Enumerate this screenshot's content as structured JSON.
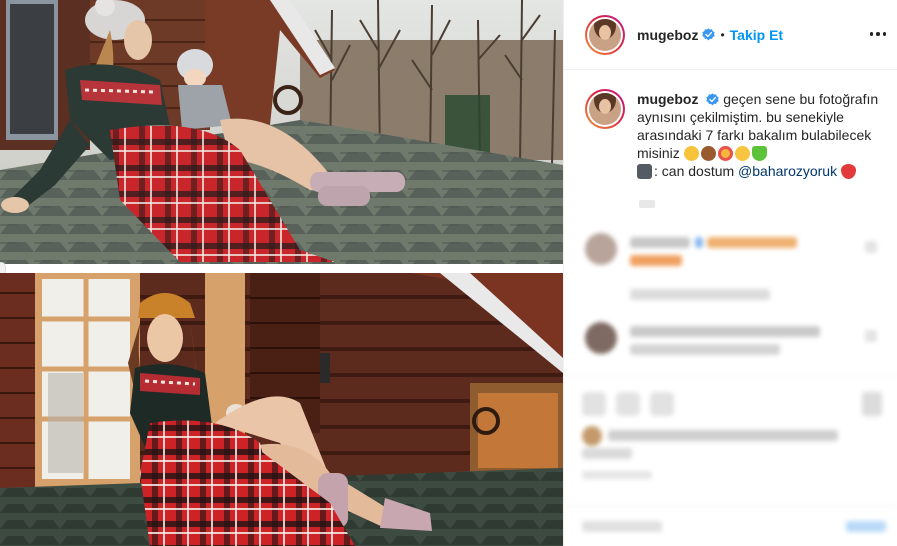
{
  "header": {
    "username": "mugeboz",
    "separator": "•",
    "follow_label": "Takip Et"
  },
  "caption": {
    "username": "mugeboz",
    "line1": "geçen sene bu fotoğrafın aynısını çekilmiştim. bu senekiyle arasındaki 7 farkı bakalım bulabilecek misiniz",
    "credit_prefix": ": can dostum",
    "credit_mention": "@baharozyoruk"
  },
  "icons": {
    "verified": "verified-badge-icon",
    "more": "more-options-icon",
    "camera": "camera-emoji",
    "strawberry": "strawberry-emoji"
  },
  "colors": {
    "accent": "#0095f6",
    "verified": "#3897f0",
    "text": "#262626",
    "divider": "#efefef"
  }
}
